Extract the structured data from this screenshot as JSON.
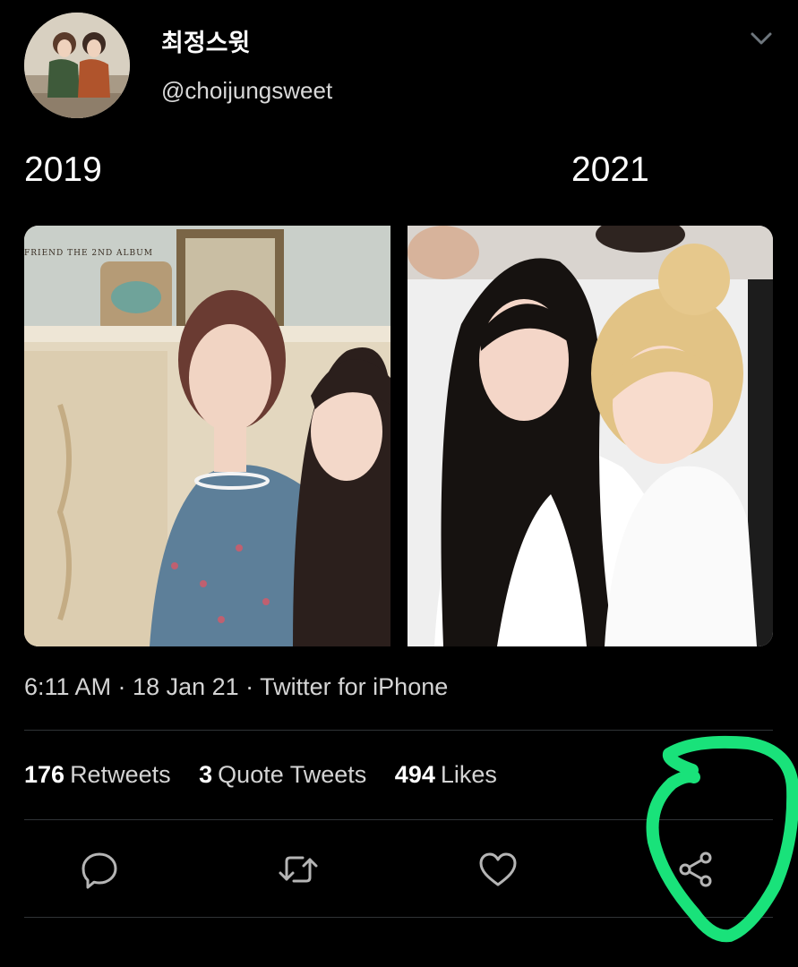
{
  "user": {
    "display_name": "최정스윗",
    "handle": "@choijungsweet"
  },
  "tweet": {
    "year_left": "2019",
    "year_right": "2021",
    "album_caption": "FRIEND THE 2ND ALBUM",
    "timestamp_line": "6:11 AM · 18 Jan 21 · Twitter for iPhone"
  },
  "stats": [
    {
      "count": "176",
      "label": "Retweets"
    },
    {
      "count": "3",
      "label": "Quote Tweets"
    },
    {
      "count": "494",
      "label": "Likes"
    }
  ],
  "actions": {
    "reply_icon": "reply-icon",
    "retweet_icon": "retweet-icon",
    "like_icon": "heart-icon",
    "share_icon": "share-icon"
  },
  "colors": {
    "background": "#000000",
    "text": "#ffffff",
    "secondary_text": "#d4d4d4",
    "icon": "#b5b5b5",
    "divider": "#2f3336",
    "annotation": "#19e27a"
  }
}
